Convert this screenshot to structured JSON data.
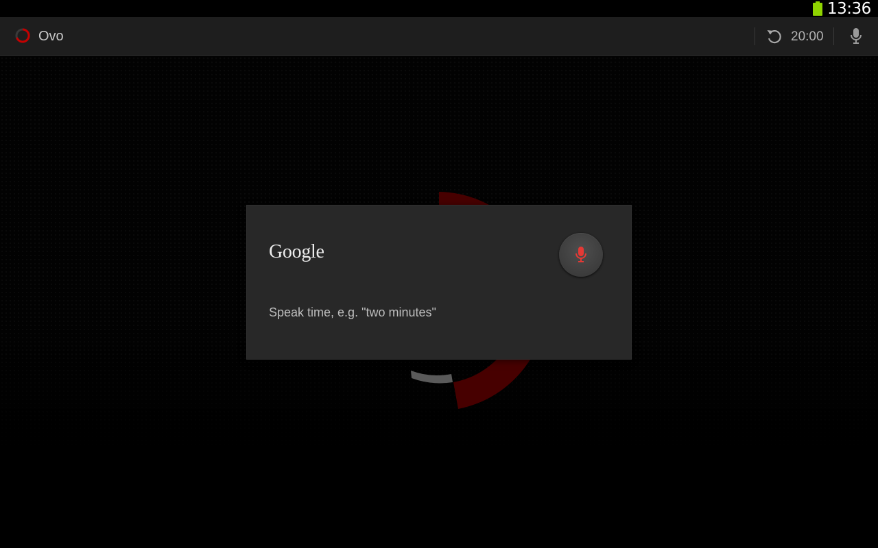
{
  "status_bar": {
    "time": "13:36",
    "battery_icon": "battery-full-icon",
    "battery_color": "#8fd400"
  },
  "action_bar": {
    "app_icon": "timer-logo-icon",
    "app_title": "Ovo",
    "reset_icon": "reset-icon",
    "reset_time": "20:00",
    "mic_icon": "microphone-icon"
  },
  "voice_dialog": {
    "brand": "Google",
    "mic_icon": "microphone-icon",
    "mic_color": "#e53935",
    "prompt": "Speak time, e.g. \"two minutes\""
  },
  "colors": {
    "accent_red": "#7a0000",
    "background": "#000000",
    "action_bar": "#1e1e1e",
    "dialog": "#282828"
  }
}
